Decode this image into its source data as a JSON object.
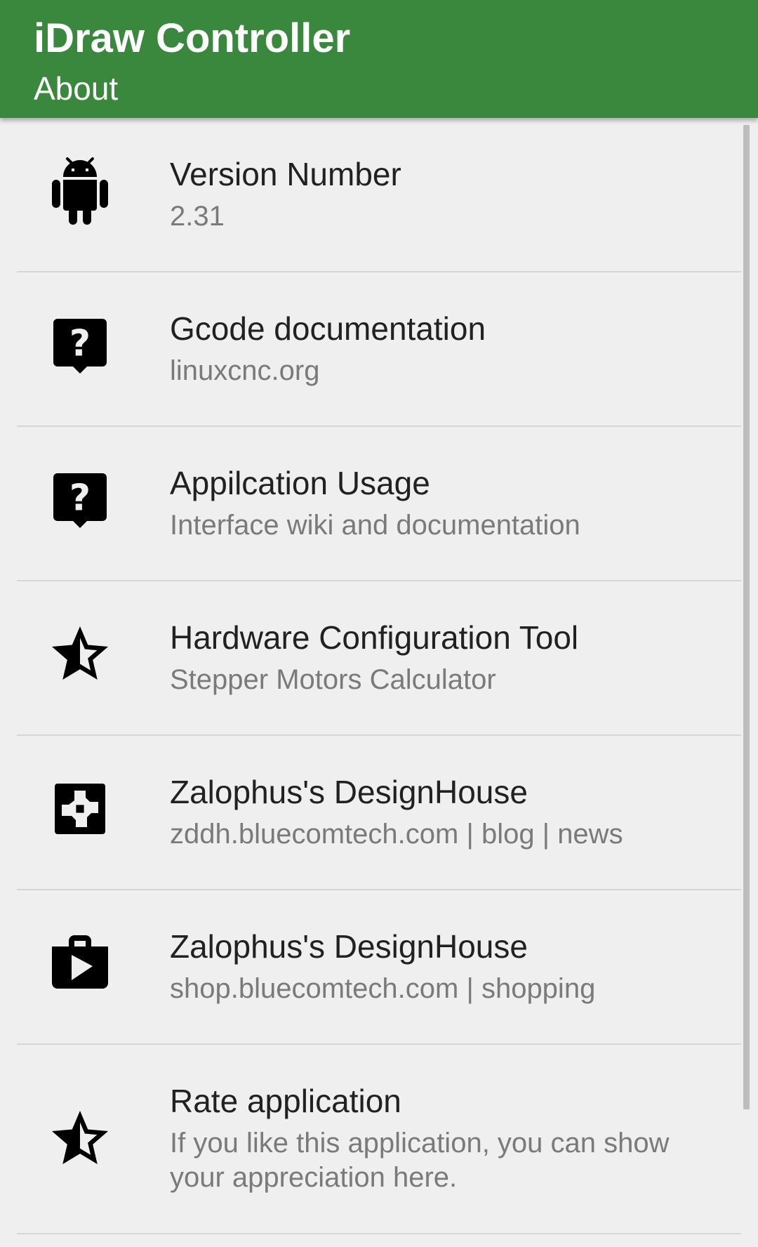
{
  "app_bar": {
    "title": "iDraw Controller",
    "subtitle": "About",
    "color": "#3a873e"
  },
  "items": [
    {
      "icon": "android-icon",
      "title": "Version Number",
      "summary": "2.31"
    },
    {
      "icon": "help-icon",
      "title": "Gcode documentation",
      "summary": "linuxcnc.org"
    },
    {
      "icon": "help-icon",
      "title": "Appilcation Usage",
      "summary": "Interface wiki and documentation"
    },
    {
      "icon": "star-half-icon",
      "title": "Hardware Configuration Tool",
      "summary": "Stepper Motors Calculator"
    },
    {
      "icon": "extension-icon",
      "title": "Zalophus's DesignHouse",
      "summary": "zddh.bluecomtech.com | blog | news"
    },
    {
      "icon": "shop-icon",
      "title": "Zalophus's DesignHouse",
      "summary": "shop.bluecomtech.com | shopping"
    },
    {
      "icon": "star-half-icon",
      "title": "Rate application",
      "summary": "If you like this application, you can show your appreciation here."
    }
  ]
}
